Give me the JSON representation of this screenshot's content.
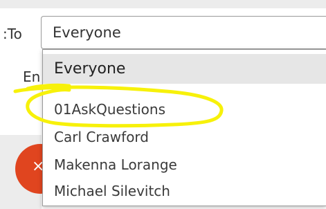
{
  "form": {
    "to_label_fragment": "To:",
    "second_label_fragment": "En"
  },
  "select": {
    "value": "Everyone"
  },
  "dropdown": {
    "selected_option": "Everyone",
    "options": [
      "01AskQuestions",
      "Carl Crawford",
      "Makenna Lorange",
      "Michael Silevitch"
    ]
  },
  "annotation": {
    "color": "#f7f10a"
  },
  "avatar": {
    "color": "#e0451f"
  }
}
